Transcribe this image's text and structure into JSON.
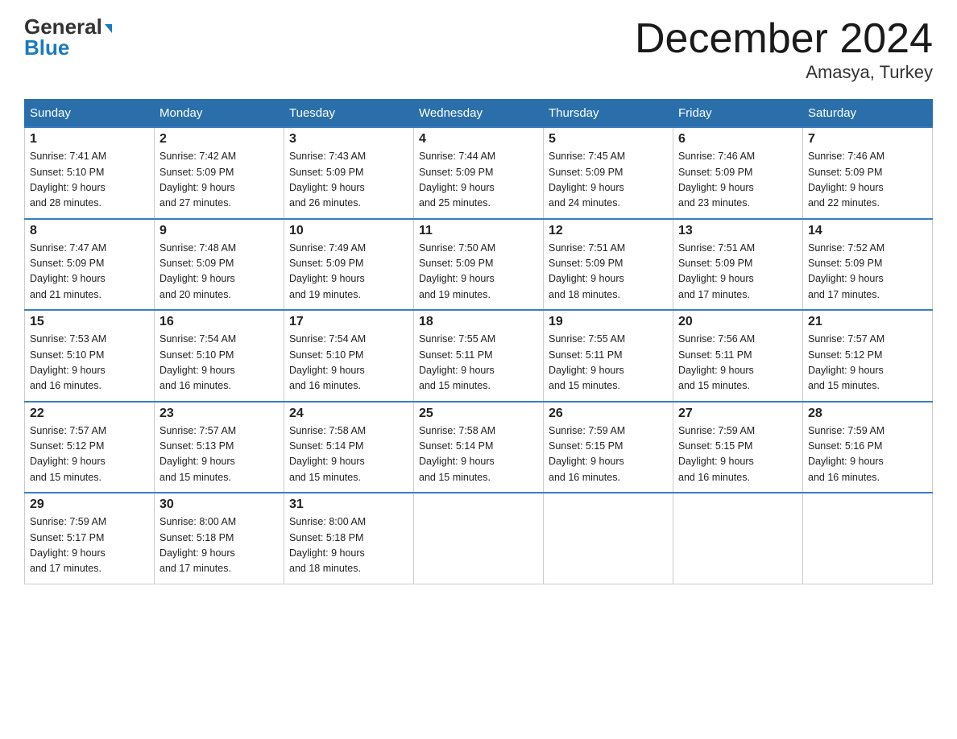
{
  "header": {
    "logo_line1": "General",
    "logo_line2": "Blue",
    "month_title": "December 2024",
    "location": "Amasya, Turkey"
  },
  "days_of_week": [
    "Sunday",
    "Monday",
    "Tuesday",
    "Wednesday",
    "Thursday",
    "Friday",
    "Saturday"
  ],
  "weeks": [
    [
      {
        "day": "1",
        "sunrise": "7:41 AM",
        "sunset": "5:10 PM",
        "daylight": "9 hours and 28 minutes."
      },
      {
        "day": "2",
        "sunrise": "7:42 AM",
        "sunset": "5:09 PM",
        "daylight": "9 hours and 27 minutes."
      },
      {
        "day": "3",
        "sunrise": "7:43 AM",
        "sunset": "5:09 PM",
        "daylight": "9 hours and 26 minutes."
      },
      {
        "day": "4",
        "sunrise": "7:44 AM",
        "sunset": "5:09 PM",
        "daylight": "9 hours and 25 minutes."
      },
      {
        "day": "5",
        "sunrise": "7:45 AM",
        "sunset": "5:09 PM",
        "daylight": "9 hours and 24 minutes."
      },
      {
        "day": "6",
        "sunrise": "7:46 AM",
        "sunset": "5:09 PM",
        "daylight": "9 hours and 23 minutes."
      },
      {
        "day": "7",
        "sunrise": "7:46 AM",
        "sunset": "5:09 PM",
        "daylight": "9 hours and 22 minutes."
      }
    ],
    [
      {
        "day": "8",
        "sunrise": "7:47 AM",
        "sunset": "5:09 PM",
        "daylight": "9 hours and 21 minutes."
      },
      {
        "day": "9",
        "sunrise": "7:48 AM",
        "sunset": "5:09 PM",
        "daylight": "9 hours and 20 minutes."
      },
      {
        "day": "10",
        "sunrise": "7:49 AM",
        "sunset": "5:09 PM",
        "daylight": "9 hours and 19 minutes."
      },
      {
        "day": "11",
        "sunrise": "7:50 AM",
        "sunset": "5:09 PM",
        "daylight": "9 hours and 19 minutes."
      },
      {
        "day": "12",
        "sunrise": "7:51 AM",
        "sunset": "5:09 PM",
        "daylight": "9 hours and 18 minutes."
      },
      {
        "day": "13",
        "sunrise": "7:51 AM",
        "sunset": "5:09 PM",
        "daylight": "9 hours and 17 minutes."
      },
      {
        "day": "14",
        "sunrise": "7:52 AM",
        "sunset": "5:09 PM",
        "daylight": "9 hours and 17 minutes."
      }
    ],
    [
      {
        "day": "15",
        "sunrise": "7:53 AM",
        "sunset": "5:10 PM",
        "daylight": "9 hours and 16 minutes."
      },
      {
        "day": "16",
        "sunrise": "7:54 AM",
        "sunset": "5:10 PM",
        "daylight": "9 hours and 16 minutes."
      },
      {
        "day": "17",
        "sunrise": "7:54 AM",
        "sunset": "5:10 PM",
        "daylight": "9 hours and 16 minutes."
      },
      {
        "day": "18",
        "sunrise": "7:55 AM",
        "sunset": "5:11 PM",
        "daylight": "9 hours and 15 minutes."
      },
      {
        "day": "19",
        "sunrise": "7:55 AM",
        "sunset": "5:11 PM",
        "daylight": "9 hours and 15 minutes."
      },
      {
        "day": "20",
        "sunrise": "7:56 AM",
        "sunset": "5:11 PM",
        "daylight": "9 hours and 15 minutes."
      },
      {
        "day": "21",
        "sunrise": "7:57 AM",
        "sunset": "5:12 PM",
        "daylight": "9 hours and 15 minutes."
      }
    ],
    [
      {
        "day": "22",
        "sunrise": "7:57 AM",
        "sunset": "5:12 PM",
        "daylight": "9 hours and 15 minutes."
      },
      {
        "day": "23",
        "sunrise": "7:57 AM",
        "sunset": "5:13 PM",
        "daylight": "9 hours and 15 minutes."
      },
      {
        "day": "24",
        "sunrise": "7:58 AM",
        "sunset": "5:14 PM",
        "daylight": "9 hours and 15 minutes."
      },
      {
        "day": "25",
        "sunrise": "7:58 AM",
        "sunset": "5:14 PM",
        "daylight": "9 hours and 15 minutes."
      },
      {
        "day": "26",
        "sunrise": "7:59 AM",
        "sunset": "5:15 PM",
        "daylight": "9 hours and 16 minutes."
      },
      {
        "day": "27",
        "sunrise": "7:59 AM",
        "sunset": "5:15 PM",
        "daylight": "9 hours and 16 minutes."
      },
      {
        "day": "28",
        "sunrise": "7:59 AM",
        "sunset": "5:16 PM",
        "daylight": "9 hours and 16 minutes."
      }
    ],
    [
      {
        "day": "29",
        "sunrise": "7:59 AM",
        "sunset": "5:17 PM",
        "daylight": "9 hours and 17 minutes."
      },
      {
        "day": "30",
        "sunrise": "8:00 AM",
        "sunset": "5:18 PM",
        "daylight": "9 hours and 17 minutes."
      },
      {
        "day": "31",
        "sunrise": "8:00 AM",
        "sunset": "5:18 PM",
        "daylight": "9 hours and 18 minutes."
      },
      null,
      null,
      null,
      null
    ]
  ],
  "labels": {
    "sunrise": "Sunrise:",
    "sunset": "Sunset:",
    "daylight": "Daylight:"
  }
}
